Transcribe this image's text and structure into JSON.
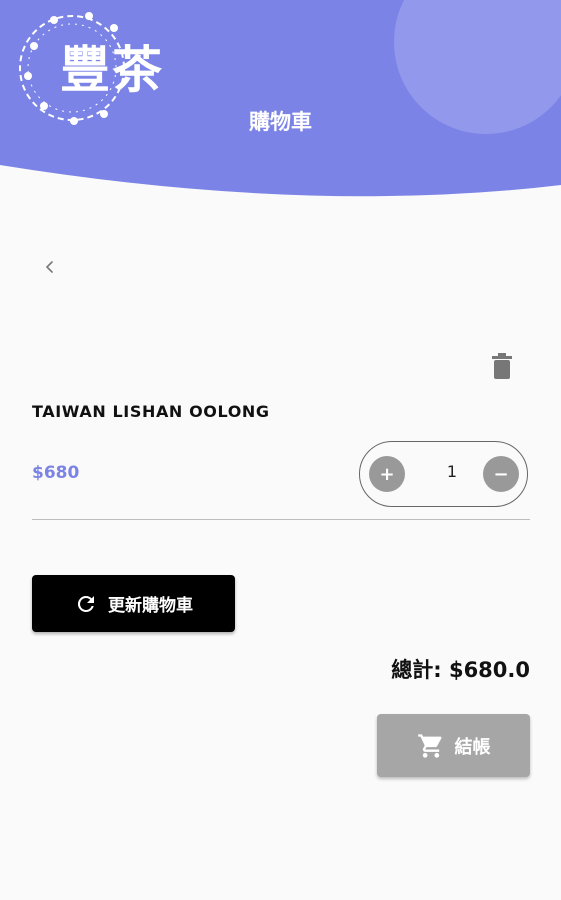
{
  "colors": {
    "header": "#7b84e6",
    "header_circle": "#9aa0ef",
    "accent": "#7b83e4",
    "update_button": "#000000",
    "checkout_button": "#a6a6a6"
  },
  "header": {
    "logo_text": "豐茶",
    "title": "購物車"
  },
  "nav": {
    "back_icon": "chevron-left-icon"
  },
  "cart": {
    "items": [
      {
        "name": "TAIWAN LISHAN OOLONG",
        "price": "$680",
        "quantity": "1",
        "plus_label": "+",
        "minus_label": "−"
      }
    ]
  },
  "actions": {
    "update_label": "更新購物車",
    "checkout_label": "結帳"
  },
  "summary": {
    "total": "總計: $680.0"
  }
}
